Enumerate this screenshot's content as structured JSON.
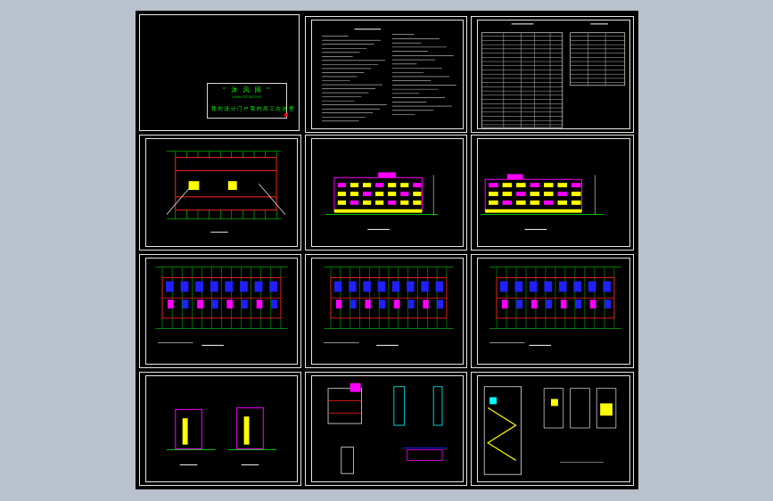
{
  "viewer": {
    "background": "#b9c1cc",
    "canvas_color": "#000000"
  },
  "logo_sheet": {
    "title": "\" 沐 风 网 \"",
    "subtitle": "www.mfcad.com",
    "slogan": "我 的 设 计 门 户  我 的 风 工  在 这 里"
  },
  "sheets": [
    {
      "kind": "cover"
    },
    {
      "kind": "notes"
    },
    {
      "kind": "schedule"
    },
    {
      "kind": "site-plan"
    },
    {
      "kind": "elevation-front"
    },
    {
      "kind": "elevation-back"
    },
    {
      "kind": "floor-plan-1"
    },
    {
      "kind": "floor-plan-2"
    },
    {
      "kind": "floor-plan-3"
    },
    {
      "kind": "side-elevations"
    },
    {
      "kind": "section-details"
    },
    {
      "kind": "stair-details"
    }
  ],
  "colors": {
    "green": "#00ff00",
    "magenta": "#ff00ff",
    "yellow": "#ffff00",
    "blue": "#2020ff",
    "red": "#ff2020",
    "cyan": "#00ffff",
    "white": "#e6e6e6"
  }
}
